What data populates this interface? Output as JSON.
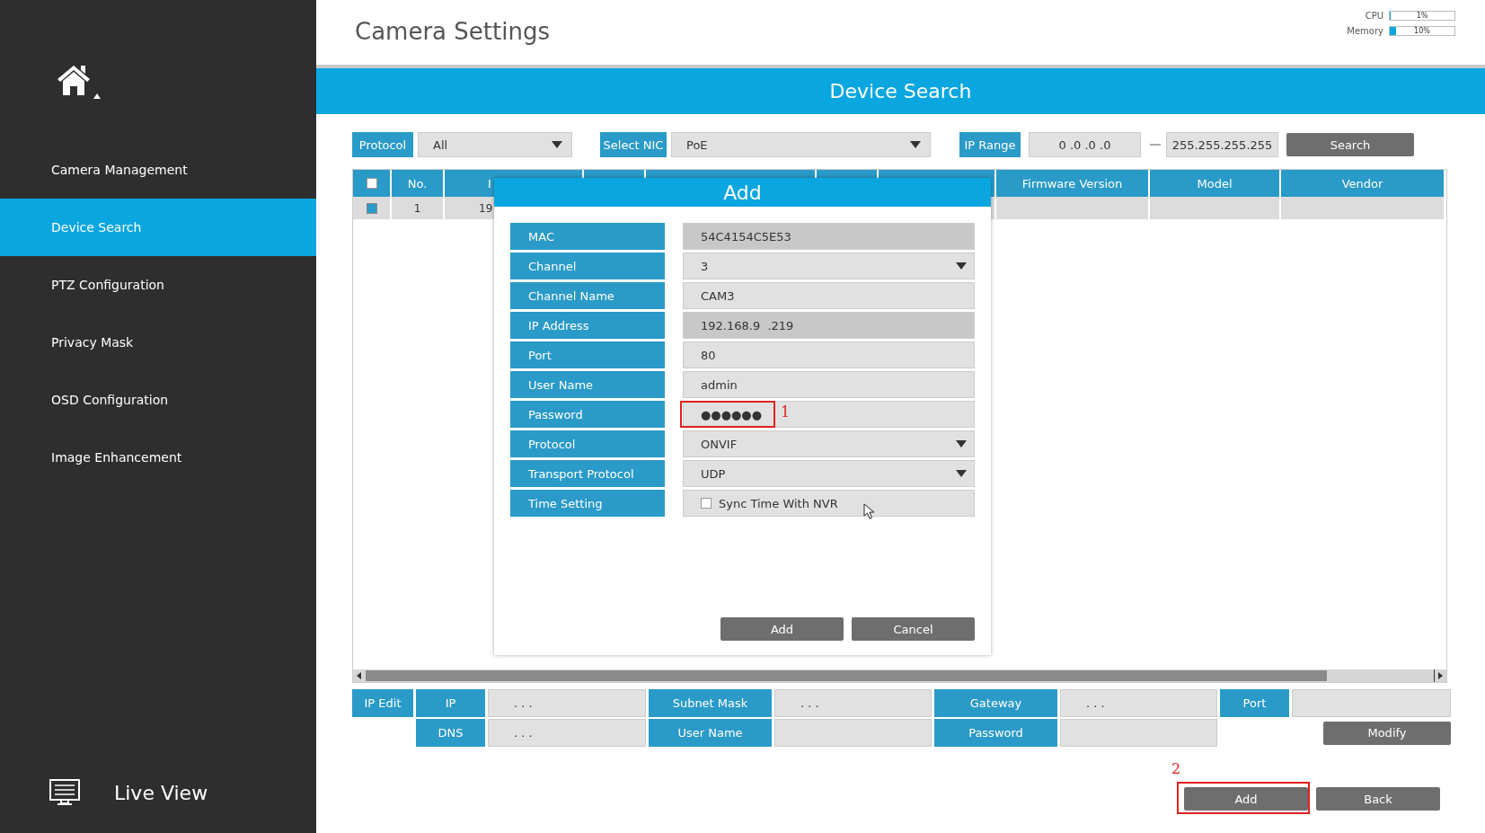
{
  "sidebar": {
    "items": [
      {
        "label": "Camera Management",
        "selected": false
      },
      {
        "label": "Device Search",
        "selected": true
      },
      {
        "label": "PTZ Configuration",
        "selected": false
      },
      {
        "label": "Privacy Mask",
        "selected": false
      },
      {
        "label": "OSD Configuration",
        "selected": false
      },
      {
        "label": "Image Enhancement",
        "selected": false
      }
    ],
    "live_view": "Live View"
  },
  "header": {
    "title": "Camera Settings",
    "meters": [
      {
        "label": "CPU",
        "level": 0.01,
        "reading": "1%"
      },
      {
        "label": "Memory",
        "level": 0.1,
        "reading": "10%"
      }
    ]
  },
  "page_title": "Device Search",
  "filters": [
    {
      "kind": "dropdown",
      "label": "Protocol",
      "value": "All"
    },
    {
      "kind": "dropdown",
      "label": "Select NIC",
      "value": "PoE"
    },
    {
      "kind": "range",
      "label": "IP Range",
      "from": "0 .0 .0 .0",
      "to": "255.255.255.255"
    }
  ],
  "search_button": "Search",
  "table": {
    "header_checked": false,
    "columns": [
      {
        "label": "No."
      },
      {
        "label": "I"
      },
      {
        "label": "Firmware Version"
      },
      {
        "label": "Model"
      },
      {
        "label": "Vendor"
      }
    ],
    "rows": [
      {
        "checked": true,
        "cells": [
          "1",
          "19"
        ]
      }
    ]
  },
  "dialog": {
    "title": "Add",
    "fields": [
      {
        "kind": "text",
        "label": "MAC",
        "value": "54C4154C5E53",
        "disabled": true
      },
      {
        "kind": "dropdown",
        "label": "Channel",
        "value": "3",
        "disabled": false
      },
      {
        "kind": "text",
        "label": "Channel Name",
        "value": "CAM3",
        "disabled": false
      },
      {
        "kind": "text",
        "label": "IP Address",
        "value": "192.168.9  .219",
        "disabled": true
      },
      {
        "kind": "text",
        "label": "Port",
        "value": "80",
        "disabled": false
      },
      {
        "kind": "text",
        "label": "User Name",
        "value": "admin",
        "disabled": false
      },
      {
        "kind": "text",
        "label": "Password",
        "value": "●●●●●●",
        "disabled": false,
        "annotation": "1"
      },
      {
        "kind": "dropdown",
        "label": "Protocol",
        "value": "ONVIF",
        "disabled": false
      },
      {
        "kind": "dropdown",
        "label": "Transport Protocol",
        "value": "UDP",
        "disabled": false
      },
      {
        "kind": "checkbox",
        "label": "Time Setting",
        "text": "Sync Time With NVR",
        "checked": false
      }
    ],
    "buttons": [
      "Add",
      "Cancel"
    ]
  },
  "ip_edit": {
    "label": "IP Edit",
    "fields": [
      {
        "label": "IP",
        "value": ". . ."
      },
      {
        "label": "Subnet Mask",
        "value": ". . ."
      },
      {
        "label": "Gateway",
        "value": ". . ."
      },
      {
        "label": "Port"
      },
      {
        "label": "DNS",
        "value": ". . ."
      },
      {
        "label": "User Name"
      },
      {
        "label": "Password"
      }
    ],
    "modify_button": "Modify"
  },
  "actions": [
    {
      "label": "Add",
      "annotation": "2"
    },
    {
      "label": "Back"
    }
  ]
}
